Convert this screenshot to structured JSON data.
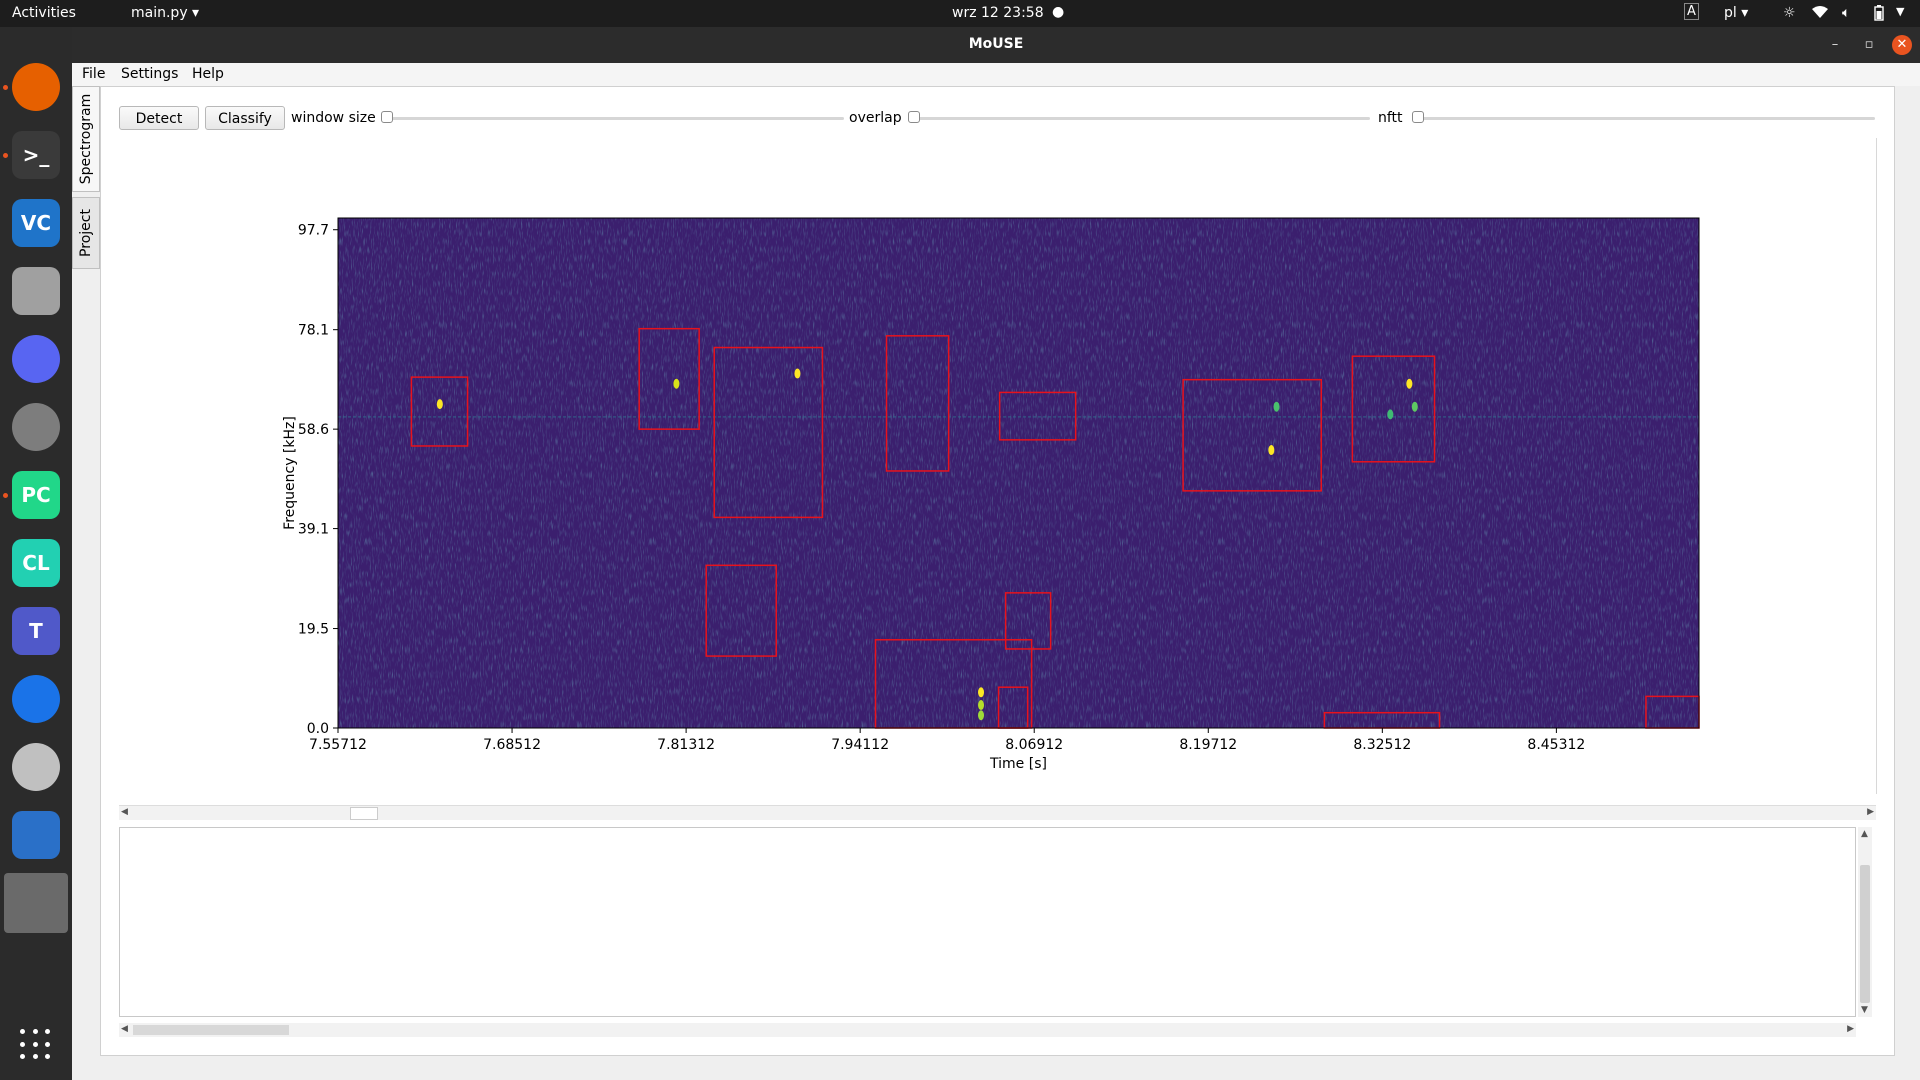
{
  "topbar": {
    "activities": "Activities",
    "app_menu": "main.py ▾",
    "clock": "wrz 12  23:58",
    "lang": "pl ▾"
  },
  "dock": {
    "items": [
      {
        "name": "firefox",
        "label": "",
        "color": "#e66000"
      },
      {
        "name": "terminal",
        "label": ">_",
        "color": "#3a3a3a"
      },
      {
        "name": "vnc",
        "label": "VC",
        "color": "#1f74c9"
      },
      {
        "name": "files",
        "label": "",
        "color": "#a0a0a0"
      },
      {
        "name": "discord",
        "label": "",
        "color": "#5865f2"
      },
      {
        "name": "settings",
        "label": "",
        "color": "#7d7d7d"
      },
      {
        "name": "pycharm",
        "label": "PC",
        "color": "#21d789"
      },
      {
        "name": "clion",
        "label": "CL",
        "color": "#22d0b2"
      },
      {
        "name": "teams",
        "label": "T",
        "color": "#5059c9"
      },
      {
        "name": "thunderbird",
        "label": "",
        "color": "#1a73e8"
      },
      {
        "name": "system",
        "label": "",
        "color": "#c0c0c0"
      },
      {
        "name": "monitor",
        "label": "",
        "color": "#2a70c8"
      },
      {
        "name": "active-window",
        "label": "",
        "color": "#6a6a6a"
      }
    ]
  },
  "window": {
    "title": "MoUSE"
  },
  "menu": {
    "file": "File",
    "settings": "Settings",
    "help": "Help"
  },
  "tabs": {
    "spectrogram": "Spectrogram",
    "project": "Project"
  },
  "toolbar": {
    "detect": "Detect",
    "classify": "Classify",
    "window_size": "window size",
    "overlap": "overlap",
    "nftt": "nftt"
  },
  "chart_data": {
    "type": "heatmap",
    "xlabel": "Time [s]",
    "ylabel": "Frequency [kHz]",
    "xticks": [
      "7.55712",
      "7.68512",
      "7.81312",
      "7.94112",
      "8.06912",
      "8.19712",
      "8.32512",
      "8.45312"
    ],
    "xtick_values": [
      7.55712,
      7.68512,
      7.81312,
      7.94112,
      8.06912,
      8.19712,
      8.32512,
      8.45312
    ],
    "yticks": [
      "0.0",
      "19.5",
      "39.1",
      "58.6",
      "78.1",
      "97.7"
    ],
    "ytick_values": [
      0.0,
      19.5,
      39.1,
      58.6,
      78.1,
      97.7
    ],
    "xlim": [
      7.55712,
      8.558
    ],
    "ylim": [
      0.0,
      100.0
    ],
    "colormap": "viridis",
    "background_color": "#3b1f6e",
    "box_color": "#e8121c",
    "detections": [
      {
        "t0": 7.6111,
        "t1": 7.6524,
        "f0": 55.3,
        "f1": 68.8
      },
      {
        "t0": 7.7786,
        "t1": 7.8227,
        "f0": 58.6,
        "f1": 78.3
      },
      {
        "t0": 7.8338,
        "t1": 7.9134,
        "f0": 41.3,
        "f1": 74.6
      },
      {
        "t0": 7.8279,
        "t1": 7.8794,
        "f0": 14.1,
        "f1": 31.9
      },
      {
        "t0": 7.9524,
        "t1": 8.0672,
        "f0": 0.0,
        "f1": 17.3
      },
      {
        "t0": 7.9605,
        "t1": 8.0062,
        "f0": 50.4,
        "f1": 76.9
      },
      {
        "t0": 8.0437,
        "t1": 8.0996,
        "f0": 56.5,
        "f1": 65.8
      },
      {
        "t0": 8.0429,
        "t1": 8.0643,
        "f0": 0.0,
        "f1": 8.0
      },
      {
        "t0": 8.0481,
        "t1": 8.0812,
        "f0": 15.5,
        "f1": 26.5
      },
      {
        "t0": 8.1786,
        "t1": 8.2802,
        "f0": 46.5,
        "f1": 68.3
      },
      {
        "t0": 8.2825,
        "t1": 8.3672,
        "f0": 0.0,
        "f1": 3.0
      },
      {
        "t0": 8.3031,
        "t1": 8.3635,
        "f0": 52.2,
        "f1": 72.9
      },
      {
        "t0": 8.519,
        "t1": 8.558,
        "f0": 0.0,
        "f1": 6.2
      }
    ],
    "calls": [
      {
        "t": 7.632,
        "f": 63.5,
        "color": "#fde725"
      },
      {
        "t": 7.806,
        "f": 67.5,
        "color": "#d8e219"
      },
      {
        "t": 7.895,
        "f": 69.5,
        "color": "#fde725"
      },
      {
        "t": 8.03,
        "f": 4.5,
        "color": "#b5de2b"
      },
      {
        "t": 8.03,
        "f": 7.0,
        "color": "#fde725"
      },
      {
        "t": 8.03,
        "f": 2.5,
        "color": "#a0da39"
      },
      {
        "t": 8.2435,
        "f": 54.5,
        "color": "#fde725"
      },
      {
        "t": 8.2473,
        "f": 63.0,
        "color": "#4ac16d"
      },
      {
        "t": 8.345,
        "f": 67.5,
        "color": "#fde725"
      },
      {
        "t": 8.349,
        "f": 63.0,
        "color": "#5ec962"
      },
      {
        "t": 8.331,
        "f": 61.5,
        "color": "#3fbc73"
      }
    ]
  }
}
